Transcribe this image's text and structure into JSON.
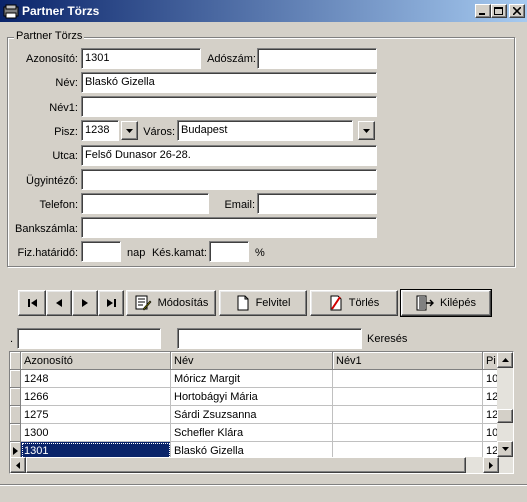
{
  "window": {
    "title": "Partner Törzs"
  },
  "form": {
    "group_title": "Partner Törzs",
    "azonosito": {
      "label": "Azonosító:",
      "value": "1301"
    },
    "adoszam": {
      "label": "Adószám:",
      "value": ""
    },
    "nev": {
      "label": "Név:",
      "value": "Blaskó Gizella"
    },
    "nev1": {
      "label": "Név1:",
      "value": ""
    },
    "pisz": {
      "label": "Pisz:",
      "value": "1238"
    },
    "varos": {
      "label": "Város:",
      "value": "Budapest"
    },
    "utca": {
      "label": "Utca:",
      "value": "Felső Dunasor 26-28."
    },
    "ugyintezo": {
      "label": "Ügyintéző:",
      "value": ""
    },
    "telefon": {
      "label": "Telefon:",
      "value": ""
    },
    "email": {
      "label": "Email:",
      "value": ""
    },
    "bankszamla": {
      "label": "Bankszámla:",
      "value": ""
    },
    "fizhatarido": {
      "label": "Fiz.határidő:",
      "value": "",
      "unit": "nap"
    },
    "keskamat": {
      "label": "Kés.kamat:",
      "value": "",
      "unit": "%"
    }
  },
  "toolbar": {
    "modositas": "Módosítás",
    "felvitel": "Felvitel",
    "torles": "Törlés",
    "kilepes": "Kilépés"
  },
  "search": {
    "prefix": ".",
    "field1_value": "",
    "field2_value": "",
    "label": "Keresés"
  },
  "grid": {
    "columns": [
      "Azonosító",
      "Név",
      "Név1",
      "Pi"
    ],
    "rows": [
      [
        "1248",
        "Móricz Margit",
        "",
        "10"
      ],
      [
        "1266",
        "Hortobágyi Mária",
        "",
        "12"
      ],
      [
        "1275",
        "Sárdi Zsuzsanna",
        "",
        "12"
      ],
      [
        "1300",
        "Schefler Klára",
        "",
        "10"
      ],
      [
        "1301",
        "Blaskó Gizella",
        "",
        "12"
      ]
    ],
    "selected_row": 4
  },
  "icons": {
    "app": "app-icon",
    "first": "first-record-icon",
    "prev": "prev-record-icon",
    "next": "next-record-icon",
    "last": "last-record-icon",
    "edit": "edit-icon",
    "new": "new-document-icon",
    "delete": "delete-icon",
    "exit": "exit-icon"
  }
}
